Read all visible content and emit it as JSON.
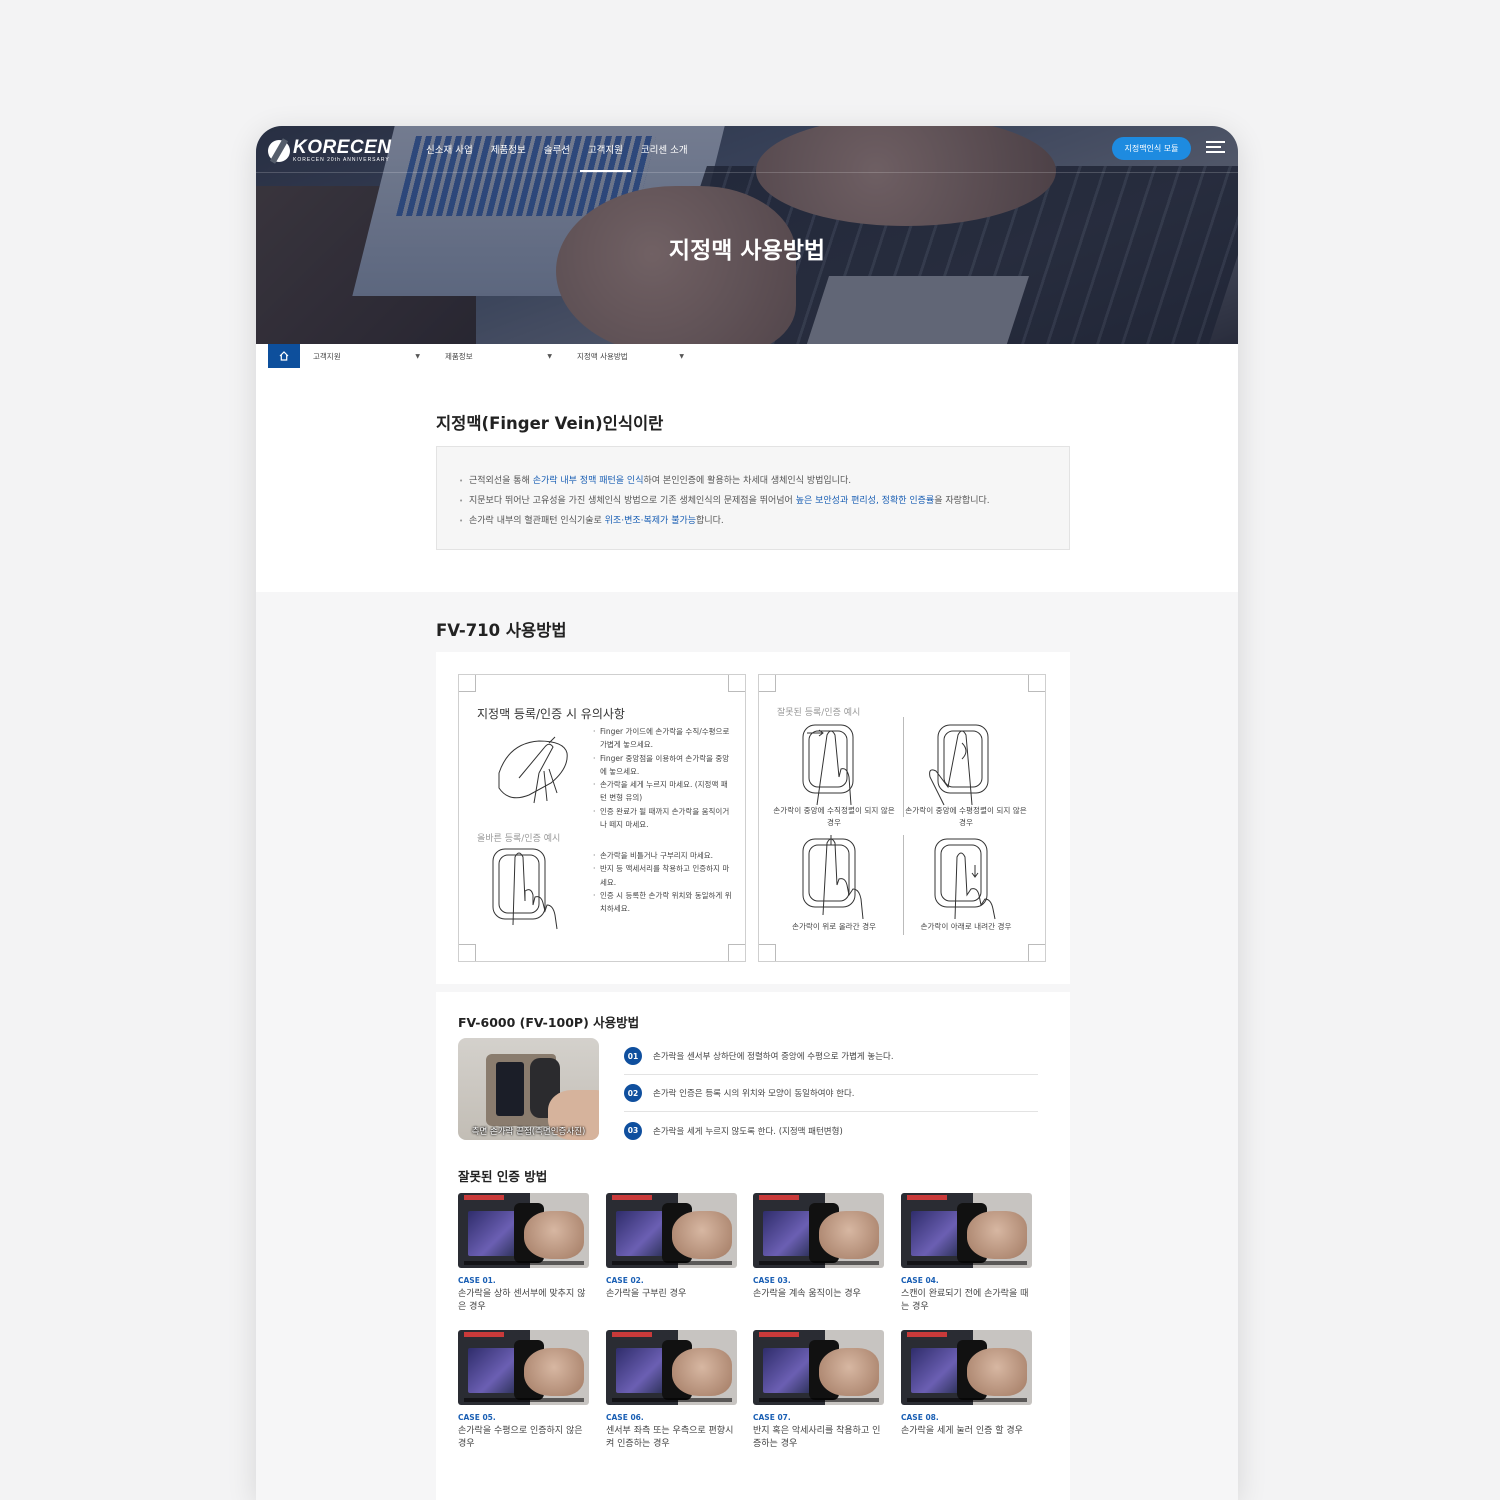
{
  "header": {
    "logo_text": "KORECEN",
    "logo_sub": "KORECEN 20th ANNIVERSARY",
    "nav": [
      "신소재 사업",
      "제품정보",
      "솔루션",
      "고객지원",
      "코리센 소개"
    ],
    "active_nav_index": 3,
    "cta_label": "지정맥인식 모듈",
    "hero_title": "지정맥 사용방법"
  },
  "breadcrumb": {
    "items": [
      "고객지원",
      "제품정보",
      "지정맥 사용방법"
    ]
  },
  "intro": {
    "title": "지정맥(Finger Vein)인식이란",
    "bullets": [
      {
        "pre": "근적외선을 통해 ",
        "hl": "손가락 내부 정맥 패턴을 인식",
        "post": "하여 본인인증에 활용하는 차세대 생체인식 방법입니다."
      },
      {
        "pre": "지문보다 뛰어난 고유성을 가진 생체인식 방법으로 기존 생체인식의 문제점을 뛰어넘어 ",
        "hl": "높은 보안성과 편리성, 정확한 인증률",
        "post": "을 자랑합니다."
      },
      {
        "pre": "손가락 내부의 혈관패턴 인식기술로 ",
        "hl": "위조·변조·복제가 불가능",
        "post": "합니다."
      }
    ]
  },
  "fv710": {
    "title": "FV-710 사용방법",
    "left_card": {
      "title": "지정맥 등록/인증 시 유의사항",
      "correct_label": "올바른 등록/인증 예시",
      "notes_top": [
        "Finger 가이드에 손가락을 수직/수평으로 가볍게 놓으세요.",
        "Finger 중앙점을 이용하여 손가락을 중앙에 놓으세요.",
        "손가락을 세게 누르지 마세요. (지정맥 패턴 변형 유의)",
        "인증 완료가 될 때까지 손가락을 움직이거나 떼지 마세요."
      ],
      "notes_bottom": [
        "손가락을 비틀거나 구부리지 마세요.",
        "반지 등 액세서리를 착용하고 인증하지 마세요.",
        "인증 시 등록한 손가락 위치와 동일하게 위치하세요."
      ]
    },
    "right_card": {
      "title": "잘못된 등록/인증 예시",
      "captions": [
        "손가락이 중앙에 수직정렬이 되지 않은 경우",
        "손가락이 중앙에 수평정렬이 되지 않은 경우",
        "손가락이 위로 올라간 경우",
        "손가락이 아래로 내려간 경우"
      ]
    }
  },
  "fv6000": {
    "title": "FV-6000 (FV-100P) 사용방법",
    "photo_caption": "측면 손가락 끝점(측면인증사진)",
    "steps": [
      {
        "num": "01",
        "text": "손가락을 센서부 상하단에 정렬하여 중앙에 수평으로 가볍게 놓는다."
      },
      {
        "num": "02",
        "text": "손가락 인증은 등록 시의 위치와 모양이 동일하여야 한다."
      },
      {
        "num": "03",
        "text": "손가락을 세게 누르지 않도록 한다. (지정맥 패턴변형)"
      }
    ],
    "wrong_title": "잘못된 인증 방법",
    "cases": [
      {
        "no": "CASE 01.",
        "text": "손가락을 상하 센서부에 맞추지 않은 경우"
      },
      {
        "no": "CASE 02.",
        "text": "손가락을 구부린 경우"
      },
      {
        "no": "CASE 03.",
        "text": "손가락을 계속 움직이는 경우"
      },
      {
        "no": "CASE 04.",
        "text": "스캔이 완료되기 전에 손가락을 때는 경우"
      },
      {
        "no": "CASE 05.",
        "text": "손가락을 수평으로 인증하지 않은 경우"
      },
      {
        "no": "CASE 06.",
        "text": "센서부 좌측 또는 우측으로 편향시켜 인증하는 경우"
      },
      {
        "no": "CASE 07.",
        "text": "반지 혹은 악세사리를 착용하고 인증하는 경우"
      },
      {
        "no": "CASE 08.",
        "text": "손가락을 세게 눌러 인증 할 경우"
      }
    ]
  },
  "colors": {
    "brand_navy": "#0d4f9c",
    "cta_blue": "#1e8be0",
    "highlight_blue": "#1a5fb4"
  },
  "icons": [
    "home-icon",
    "hamburger-menu-icon",
    "dropdown-arrow-icon"
  ]
}
